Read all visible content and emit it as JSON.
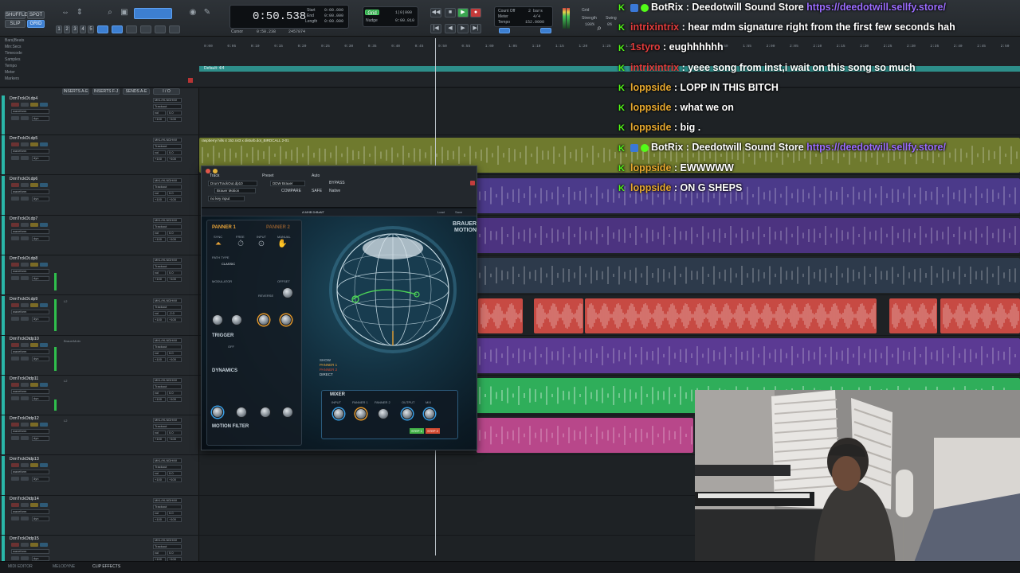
{
  "toolbar": {
    "edit_modes": [
      "SHUFFLE",
      "SPOT",
      "SLIP",
      "GRID"
    ],
    "counter_main": "0:50.538",
    "counter_labels": [
      "Start",
      "End",
      "Length"
    ],
    "counter_values": [
      "0:00.000",
      "0:00.000",
      "0:00.000"
    ],
    "cursor_label": "Cursor",
    "cursor_value": "0:50.238",
    "sample_value": "2457874",
    "nudge_label": "Nudge",
    "grid_label": "Grid",
    "count_off_label": "Count Off",
    "count_off_value": "2 bars",
    "meter_label": "Meter",
    "meter_value": "4/4",
    "tempo_label": "Tempo",
    "tempo_value": "152.0000",
    "strength_label": "Strength",
    "swing_label": "Swing",
    "strength_value": "100%",
    "swing_value": "0%"
  },
  "rulers": {
    "names": [
      "Bars|Beats",
      "Min:Secs",
      "Timecode",
      "Samples",
      "Tempo",
      "Meter",
      "Markers"
    ],
    "time_ticks": [
      "0:00",
      "0:05",
      "0:10",
      "0:15",
      "0:20",
      "0:25",
      "0:30",
      "0:35",
      "0:40",
      "0:45",
      "0:50",
      "0:55",
      "1:00",
      "1:05",
      "1:10",
      "1:15",
      "1:20",
      "1:25",
      "1:30",
      "1:35",
      "1:40",
      "1:45",
      "1:50",
      "1:55",
      "2:00",
      "2:05",
      "2:10",
      "2:15",
      "2:20",
      "2:25",
      "2:30",
      "2:35",
      "2:40",
      "2:45",
      "2:50"
    ],
    "marker_label": "Default: 4/4",
    "tempo_marker": "152"
  },
  "mix_columns": [
    "INSERTS A-E",
    "INSERTS F-J",
    "SENDS A-E",
    "I / O"
  ],
  "tracks": [
    {
      "name": "DrmTrckOt.dp4",
      "io": "MKL/HLNDH/W",
      "vol": "vol",
      "val": "+100",
      "val2": "0.0",
      "insert": ""
    },
    {
      "name": "DrmTrckOt.dp5",
      "io": "MKL/HLNDH/W",
      "vol": "vol",
      "val": "+100",
      "val2": "0.0",
      "insert": ""
    },
    {
      "name": "DrmTrckOt.dp6",
      "io": "MKL/HLNDH/W",
      "vol": "vol",
      "val": "+100",
      "val2": "0.0",
      "insert": ""
    },
    {
      "name": "DrmTrckOt.dp7",
      "io": "MKL/HLNDH/W",
      "vol": "vol",
      "val": "+100",
      "val2": "0.0",
      "insert": ""
    },
    {
      "name": "DrmTrckOt.dp8",
      "io": "MKL/HLNDH/W",
      "vol": "vol",
      "val": "+100",
      "val2": "0.0",
      "insert": ""
    },
    {
      "name": "DrmTrckOt.dp9",
      "io": "MKL/HLNDH/W",
      "vol": "vol",
      "val": "+100",
      "val2": "-2.0",
      "insert": "L2"
    },
    {
      "name": "DrmTrckOtdp10",
      "io": "MKL/HLNDH/W",
      "vol": "vol",
      "val": "+100",
      "val2": "0.0",
      "insert": "BrauerMotn"
    },
    {
      "name": "DrmTrckOtdp11",
      "io": "MKL/HLNDH/W",
      "vol": "vol",
      "val": "+100",
      "val2": "0.0",
      "insert": "L2"
    },
    {
      "name": "DrmTrckOtdp12",
      "io": "MKL/HLNDH/W",
      "vol": "vol",
      "val": "+100",
      "val2": "0.0",
      "insert": "L2"
    },
    {
      "name": "DrmTrckOtdp13",
      "io": "MKL/HLNDH/W",
      "vol": "vol",
      "val": "+100",
      "val2": "0.0",
      "insert": ""
    },
    {
      "name": "DrmTrckOtdp14",
      "io": "MKL/HLNDH/W",
      "vol": "vol",
      "val": "+100",
      "val2": "0.0",
      "insert": ""
    },
    {
      "name": "DrmTrckOtdp15",
      "io": "MKL/HLNDH/W",
      "vol": "vol",
      "val": "+100",
      "val2": "0.0",
      "insert": ""
    }
  ],
  "lanes": [
    {
      "color": "",
      "clips": []
    },
    {
      "color": "#6f7a2e",
      "clips": [
        {
          "title": "raspberry hills 4 152.rxt3 x disturb.dot_BIRDCALL 2-01",
          "start": 0,
          "end": 1030
        }
      ]
    },
    {
      "color": "#4b3a8a",
      "clips": [
        {
          "title": "",
          "start": 348,
          "end": 1030
        }
      ]
    },
    {
      "color": "#4c3380",
      "clips": [
        {
          "title": "",
          "start": 348,
          "end": 1030
        }
      ]
    },
    {
      "color": "#2d3a4b",
      "clips": [
        {
          "title": "",
          "start": 348,
          "end": 1030
        }
      ]
    },
    {
      "color": "#c74a43",
      "clips": [
        {
          "title": "",
          "start": 350,
          "end": 406
        },
        {
          "title": "",
          "start": 420,
          "end": 482
        },
        {
          "title": "",
          "start": 484,
          "end": 850
        },
        {
          "title": "",
          "start": 866,
          "end": 926
        },
        {
          "title": "",
          "start": 930,
          "end": 1030
        }
      ]
    },
    {
      "color": "#5b3a93",
      "clips": [
        {
          "title": "",
          "start": 348,
          "end": 1030
        }
      ]
    },
    {
      "color": "#2fae5a",
      "clips": [
        {
          "title": "",
          "start": 348,
          "end": 1030
        }
      ]
    },
    {
      "color": "#b8478a",
      "clips": [
        {
          "title": "",
          "start": 348,
          "end": 620
        }
      ]
    },
    {
      "color": "",
      "clips": []
    },
    {
      "color": "",
      "clips": []
    },
    {
      "color": "",
      "clips": []
    }
  ],
  "plugin": {
    "track_label": "Track",
    "preset_label": "Preset",
    "auto_label": "Auto",
    "track_value": "DrumTrackOut.dp10",
    "preset_value": "DDW Brauer",
    "plugin_name": "Brauer Motion",
    "compare": "COMPARE",
    "safe": "SAFE",
    "native": "Native",
    "bypass": "BYPASS",
    "key_input": "no key input",
    "toolbar_mid": "A MHB DrBaNT",
    "load": "Load",
    "save": "Save",
    "brand": "BRAUER MOTION",
    "panner1": "PANNER 1",
    "panner2": "PANNER 2",
    "sync": "SYNC",
    "free": "FREE",
    "input": "INPUT",
    "manual": "MANUAL",
    "path_type": "PATH TYPE",
    "classic": "CLASSIC",
    "modulator": "MODULATOR",
    "offset": "OFFSET",
    "reverse": "REVERSE",
    "trigger": "TRIGGER",
    "off": "OFF",
    "dynamics": "DYNAMICS",
    "motion_filter": "MOTION FILTER",
    "mixer": "MIXER",
    "show": "SHOW",
    "show_items": [
      "PANNER 1",
      "PANNER 2",
      "DIRECT"
    ],
    "step1": "STEP 1",
    "step2": "STEP 2",
    "mixer_knobs": [
      "INPUT",
      "PANNER 1",
      "PANNER 2",
      "OUTPUT",
      "MIX"
    ]
  },
  "chat": [
    {
      "user": "BotRix",
      "user_color": "#ffffff",
      "text": "Deedotwill Sound Store",
      "link": "https://deedotwill.sellfy.store/",
      "badges": true
    },
    {
      "user": "intrixintrix",
      "user_color": "#e23c3c",
      "text": "hear mdm signature right from the first few seconds hah",
      "link": "",
      "badges": false
    },
    {
      "user": "1styro",
      "user_color": "#e23c3c",
      "text": "eughhhhhh",
      "link": "",
      "badges": false
    },
    {
      "user": "intrixintrix",
      "user_color": "#e23c3c",
      "text": "yeee song from inst,i wait on this song so much",
      "link": "",
      "badges": false
    },
    {
      "user": "loppside",
      "user_color": "#e8a92e",
      "text": "LOPP IN THIS BITCH",
      "link": "",
      "badges": false
    },
    {
      "user": "loppside",
      "user_color": "#e8a92e",
      "text": "what we on",
      "link": "",
      "badges": false
    },
    {
      "user": "loppside",
      "user_color": "#e8a92e",
      "text": "big .",
      "link": "",
      "badges": false
    },
    {
      "user": "BotRix",
      "user_color": "#ffffff",
      "text": "Deedotwill Sound Store",
      "link": "https://deedotwill.sellfy.store/",
      "badges": true
    },
    {
      "user": "loppside",
      "user_color": "#e8a92e",
      "text": "EWWWWW",
      "link": "",
      "badges": false
    },
    {
      "user": "loppside",
      "user_color": "#e8a92e",
      "text": "ON G SHEPS",
      "link": "",
      "badges": false
    }
  ],
  "bottom": {
    "tabs": [
      "MIDI EDITOR",
      "MELODYNE",
      "CLIP EFFECTS"
    ],
    "active_tab": "CLIP EFFECTS"
  },
  "colors": {
    "track_accent": "#2ab6a8",
    "kick_green": "#53fc18",
    "plugin_orange": "#e8a338"
  }
}
